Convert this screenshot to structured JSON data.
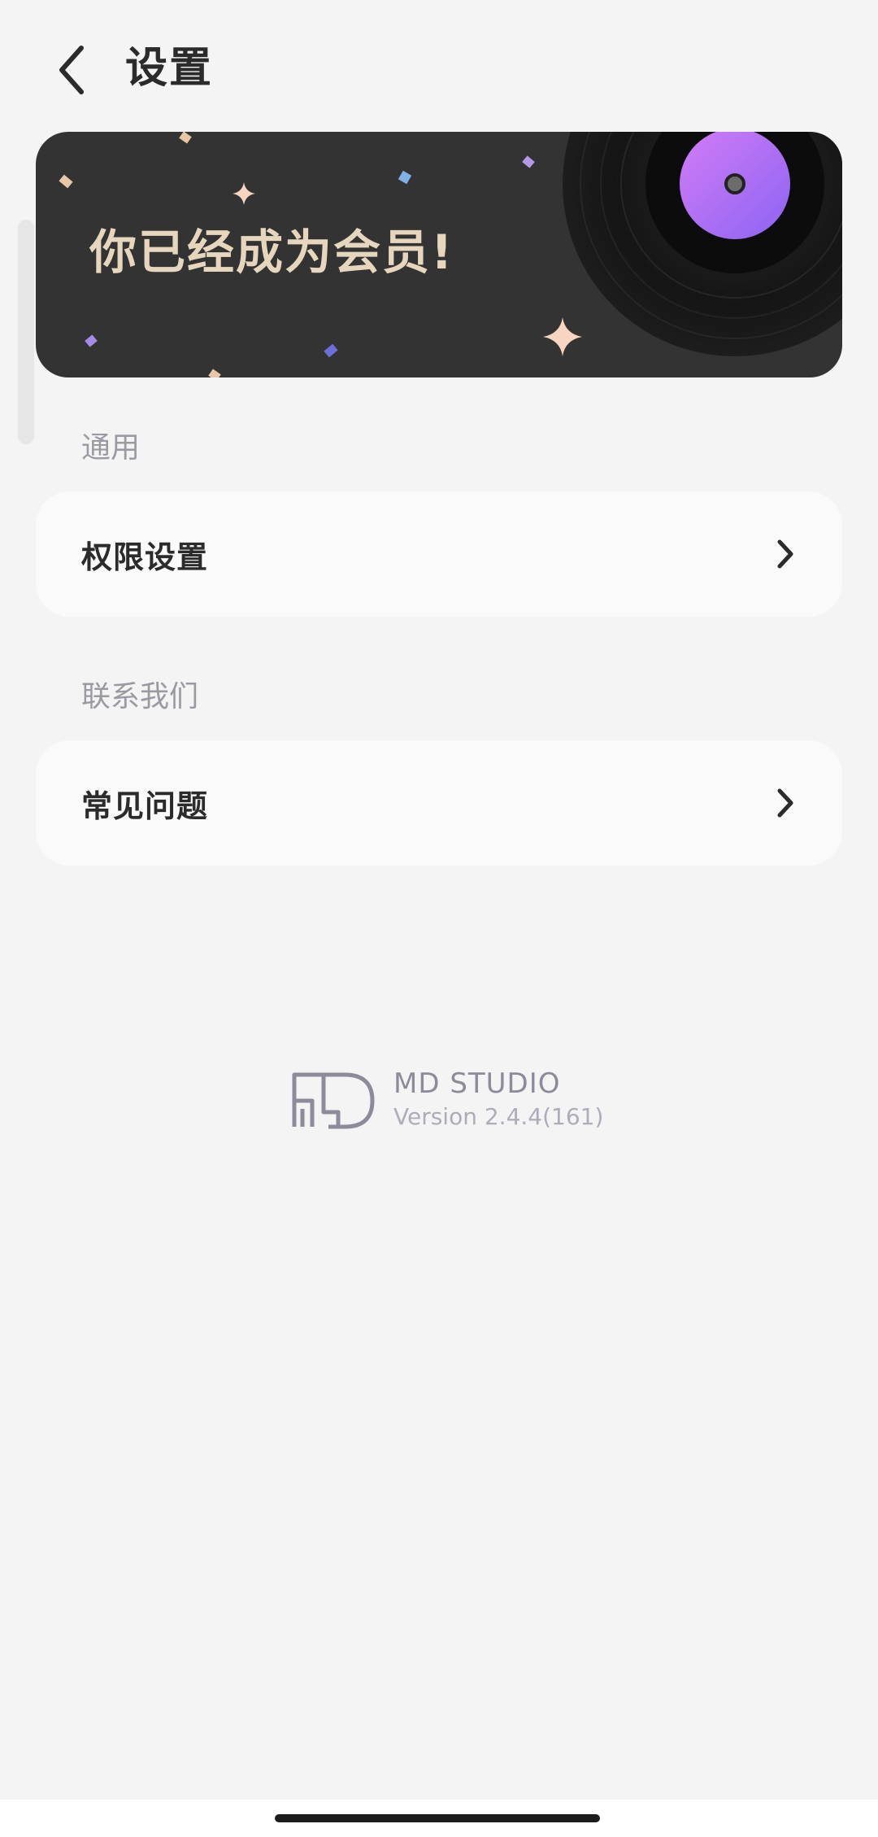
{
  "header": {
    "title": "设置"
  },
  "banner": {
    "text": "你已经成为会员!"
  },
  "sections": [
    {
      "label": "通用",
      "items": [
        {
          "label": "权限设置"
        }
      ]
    },
    {
      "label": "联系我们",
      "items": [
        {
          "label": "常见问题"
        }
      ]
    }
  ],
  "footer": {
    "brand": "MD STUDIO",
    "version": "Version 2.4.4(161)"
  },
  "colors": {
    "background": "#f4f4f4",
    "banner_bg": "#333333",
    "banner_text": "#e6d6bd",
    "record_label": "#b56cf5",
    "section_label": "#9b9aa3",
    "card_bg": "#fafafa"
  },
  "icons": {
    "back": "chevron-left-icon",
    "item_arrow": "chevron-right-icon",
    "logo": "md-studio-logo-icon",
    "record": "vinyl-record-icon"
  }
}
